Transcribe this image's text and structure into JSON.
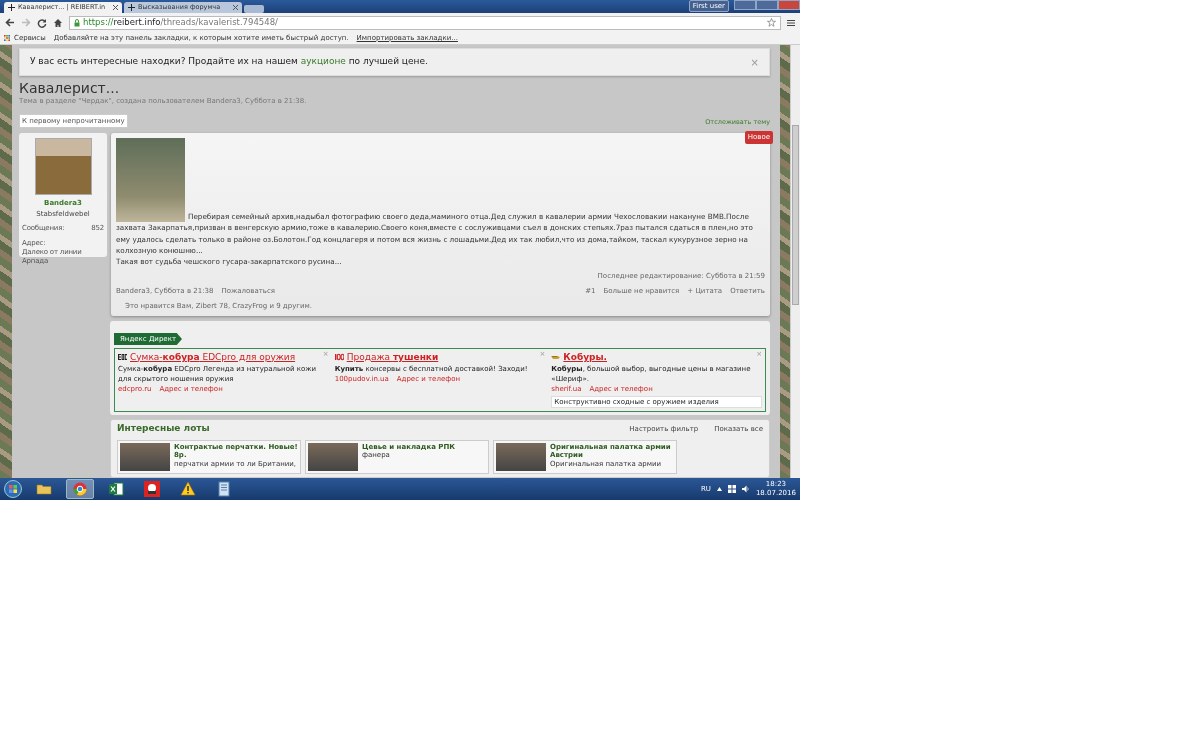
{
  "browser": {
    "tabs": [
      {
        "title": "Кавалерист... | REIBERT.in",
        "selected": true
      },
      {
        "title": "Высказывания форумча",
        "selected": false
      }
    ],
    "user_button": "First user",
    "url": {
      "scheme": "https://",
      "host": "reibert.info",
      "path": "/threads/kavalerist.794548/"
    },
    "bookmarks": {
      "apps": "Сервисы",
      "hint": "Добавляйте на эту панель закладки, к которым хотите иметь быстрый доступ.",
      "import_link": "Импортировать закладки..."
    }
  },
  "notice": {
    "text": "У вас есть интересные находки? Продайте их на нашем ",
    "link": "аукционе",
    "text_after": " по лучшей цене.",
    "close": "×"
  },
  "thread": {
    "title": "Кавалерист...",
    "meta": "Тема в разделе \"Чердак\", создана пользователем Bandera3, Суббота в 21:38.",
    "unread_button": "К первому непрочитанному",
    "watch_link": "Отслеживать тему"
  },
  "post": {
    "author": "Bandera3",
    "rank": "Stabsfeldwebel",
    "stats": [
      {
        "label": "Сообщения:",
        "value": "852"
      }
    ],
    "location_label": "Адрес:",
    "location": "Далеко от линии Арпада",
    "badge": "Новое",
    "paragraphs": [
      "Перебирая семейный архив,надыбал фотографию своего деда,маминого отца.Дед служил в кавалерии армии Чехословакии накануне ВМВ.После захвата Закарпатья,призван в венгерскую армию,тоже в кавалерию.Своего коня,вместе с сослуживцами съел в донских степьях.7раз пытался сдаться в плен,но это ему удалось сделать только в районе оз.Болотон.Год концлагеря и потом вся жизнь с лошадьми.Дед их так любил,что из дома,тайком, таскал кукурузное зерно на колхозную конюшню...",
      "Такая вот судьба чешского гусара-закарпатского русина..."
    ],
    "edited": "Последнее редактирование: Суббота в 21:59",
    "byline": "Bandera3, Суббота в 21:38",
    "report": "Пожаловаться",
    "actions": [
      "#1",
      "Больше не нравится",
      "+ Цитата",
      "Ответить"
    ],
    "likes": "Это нравится Вам, Zibert 78, CrazyFrog и 9 другим."
  },
  "ads": {
    "label": "Яндекс Директ",
    "items": [
      {
        "kind": "edc",
        "title": "Сумка-**кобура** EDCpro для оружия",
        "text": "Сумка-**кобура** EDCpro Легенда из натуральной кожи для скрытого ношения оружия",
        "domain": "edcpro.ru",
        "contact": "Адрес и телефон",
        "close": "×"
      },
      {
        "kind": "hundred",
        "title": "Продажа **тушенки**",
        "text": "**Купить** консервы с бесплатной доставкой! Заходи!",
        "domain": "100pudov.in.ua",
        "contact": "Адрес и телефон",
        "close": "×"
      },
      {
        "kind": "holster",
        "title": "**Кобуры.**",
        "text": "**Кобуры**, большой выбор, выгодные цены в магазине «Шериф».",
        "domain": "sherif.ua",
        "contact": "Адрес и телефон",
        "close": "×",
        "note": "Конструктивно сходные с оружием изделия"
      }
    ]
  },
  "lots": {
    "title": "Интересные лоты",
    "links": [
      "Настроить фильтр",
      "Показать все"
    ],
    "items": [
      {
        "title": "Контрактые перчатки. Новые! 8р.",
        "text": "перчатки армии то ли Британии,"
      },
      {
        "title": "Цевье и накладка РПК",
        "text": "фанера"
      },
      {
        "title": "Оригинальная палатка армии Австрии",
        "text": "Оригинальная палатка армии"
      }
    ]
  },
  "taskbar": {
    "apps": [
      {
        "kind": "folder",
        "selected": false
      },
      {
        "kind": "browser",
        "selected": true
      },
      {
        "kind": "spreadsheet",
        "selected": false
      },
      {
        "kind": "tool",
        "selected": false
      },
      {
        "kind": "warning",
        "selected": false
      },
      {
        "kind": "document",
        "selected": false
      }
    ],
    "lang": "RU",
    "time": "18:23",
    "date": "18.07.2016"
  }
}
